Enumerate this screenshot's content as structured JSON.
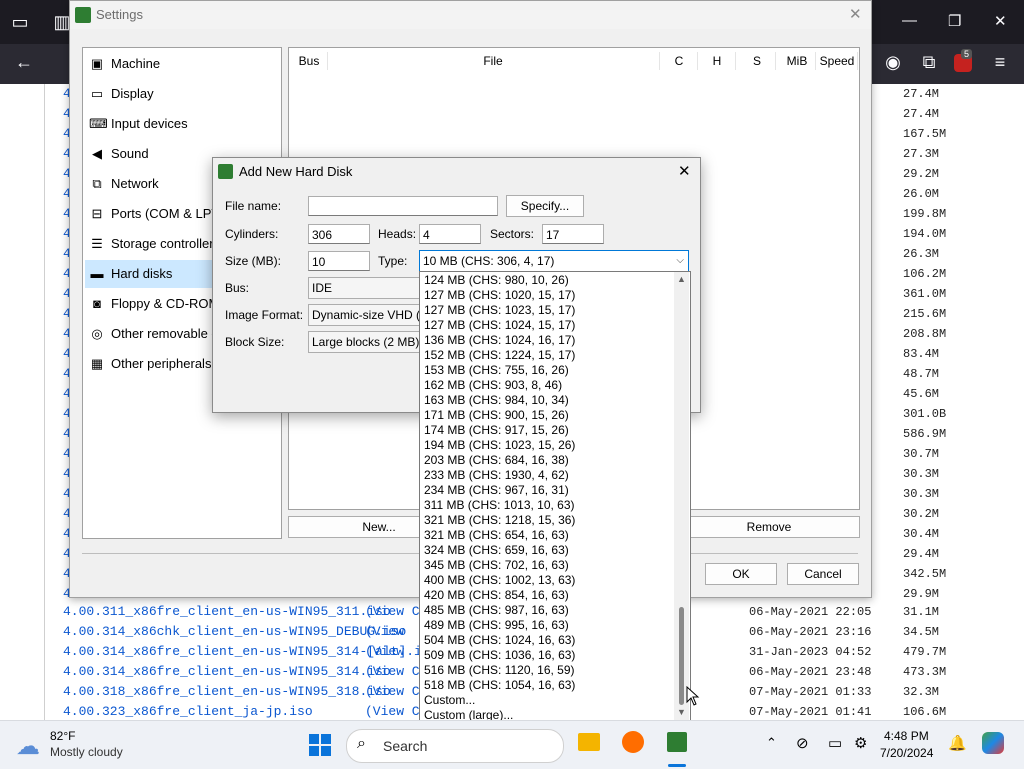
{
  "browser": {
    "list_sizes": [
      "27.4M",
      "27.4M",
      "167.5M",
      "27.3M",
      "29.2M",
      "26.0M",
      "199.8M",
      "194.0M",
      "26.3M",
      "106.2M",
      "361.0M",
      "215.6M",
      "208.8M",
      "83.4M",
      "48.7M",
      "45.6M",
      "301.0B",
      "586.9M",
      "30.7M",
      "30.3M",
      "30.3M",
      "30.2M",
      "30.4M",
      "29.4M",
      "342.5M",
      "29.9M"
    ],
    "list_rows": [
      {
        "name": "4.00.311_x86fre_client_en-us-WIN95_311.iso",
        "link": "(View Co",
        "date": "06-May-2021 22:05",
        "size": "31.1M"
      },
      {
        "name": "4.00.314_x86chk_client_en-us-WIN95_DEBUG.iso",
        "link": "(View",
        "date": "06-May-2021 23:16",
        "size": "34.5M"
      },
      {
        "name": "4.00.314_x86fre_client_en-us-WIN95_314-[alt].iso",
        "link": "(View",
        "date": "31-Jan-2023 04:52",
        "size": "479.7M"
      },
      {
        "name": "4.00.314_x86fre_client_en-us-WIN95_314.iso",
        "link": "(View Co",
        "date": "06-May-2021 23:48",
        "size": "473.3M"
      },
      {
        "name": "4.00.318_x86fre_client_en-us-WIN95_318.iso",
        "link": "(View Co",
        "date": "07-May-2021 01:33",
        "size": "32.3M"
      },
      {
        "name": "4.00.323_x86fre_client_ja-jp.iso",
        "link": "(View Contents)",
        "date": "07-May-2021 01:41",
        "size": "106.6M"
      }
    ],
    "badge_count": "5"
  },
  "settings": {
    "title": "Settings",
    "nav": [
      {
        "label": "Machine",
        "icon": "machine-icon",
        "glyph": "▣"
      },
      {
        "label": "Display",
        "icon": "display-icon",
        "glyph": "▭"
      },
      {
        "label": "Input devices",
        "icon": "keyboard-icon",
        "glyph": "⌨"
      },
      {
        "label": "Sound",
        "icon": "speaker-icon",
        "glyph": "◀"
      },
      {
        "label": "Network",
        "icon": "network-icon",
        "glyph": "⧉"
      },
      {
        "label": "Ports (COM & LPT)",
        "icon": "port-icon",
        "glyph": "⊟"
      },
      {
        "label": "Storage controllers",
        "icon": "storage-icon",
        "glyph": "☰"
      },
      {
        "label": "Hard disks",
        "icon": "hard-disk-icon",
        "glyph": "▬"
      },
      {
        "label": "Floppy & CD-ROM d",
        "icon": "floppy-icon",
        "glyph": "◙"
      },
      {
        "label": "Other removable de",
        "icon": "removable-icon",
        "glyph": "◎"
      },
      {
        "label": "Other peripherals",
        "icon": "peripherals-icon",
        "glyph": "▦"
      }
    ],
    "columns": [
      "Bus",
      "File",
      "C",
      "H",
      "S",
      "MiB",
      "Speed"
    ],
    "new_button": "New...",
    "remove_button": "Remove",
    "ok_button": "OK",
    "cancel_button": "Cancel"
  },
  "dialog": {
    "title": "Add New Hard Disk",
    "file_name_label": "File name:",
    "file_name_value": "",
    "specify_button": "Specify...",
    "cylinders_label": "Cylinders:",
    "cylinders_value": "306",
    "heads_label": "Heads:",
    "heads_value": "4",
    "sectors_label": "Sectors:",
    "sectors_value": "17",
    "size_label": "Size (MB):",
    "size_value": "10",
    "type_label": "Type:",
    "type_value": "10 MB (CHS: 306, 4, 17)",
    "bus_label": "Bus:",
    "bus_value": "IDE",
    "image_format_label": "Image Format:",
    "image_format_value": "Dynamic-size VHD (.",
    "block_size_label": "Block Size:",
    "block_size_value": "Large blocks (2 MB)"
  },
  "type_options": [
    "124 MB (CHS: 980, 10, 26)",
    "127 MB (CHS: 1020, 15, 17)",
    "127 MB (CHS: 1023, 15, 17)",
    "127 MB (CHS: 1024, 15, 17)",
    "136 MB (CHS: 1024, 16, 17)",
    "152 MB (CHS: 1224, 15, 17)",
    "153 MB (CHS: 755, 16, 26)",
    "162 MB (CHS: 903, 8, 46)",
    "163 MB (CHS: 984, 10, 34)",
    "171 MB (CHS: 900, 15, 26)",
    "174 MB (CHS: 917, 15, 26)",
    "194 MB (CHS: 1023, 15, 26)",
    "203 MB (CHS: 684, 16, 38)",
    "233 MB (CHS: 1930, 4, 62)",
    "234 MB (CHS: 967, 16, 31)",
    "311 MB (CHS: 1013, 10, 63)",
    "321 MB (CHS: 1218, 15, 36)",
    "321 MB (CHS: 654, 16, 63)",
    "324 MB (CHS: 659, 16, 63)",
    "345 MB (CHS: 702, 16, 63)",
    "400 MB (CHS: 1002, 13, 63)",
    "420 MB (CHS: 854, 16, 63)",
    "485 MB (CHS: 987, 16, 63)",
    "489 MB (CHS: 995, 16, 63)",
    "504 MB (CHS: 1024, 16, 63)",
    "509 MB (CHS: 1036, 16, 63)",
    "516 MB (CHS: 1120, 16, 59)",
    "518 MB (CHS: 1054, 16, 63)",
    "Custom...",
    "Custom (large)..."
  ],
  "taskbar": {
    "temperature": "82°F",
    "weather": "Mostly cloudy",
    "search_label": "Search",
    "time": "4:48 PM",
    "date": "7/20/2024"
  }
}
